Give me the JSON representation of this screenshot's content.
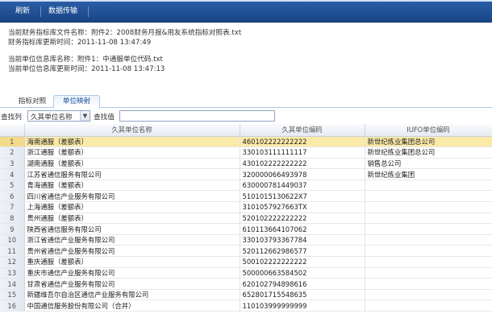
{
  "toolbar": {
    "refresh_label": "刷新",
    "transfer_label": "数据传输"
  },
  "info": {
    "finance_file_label": "当前财务指标库文件名称：附件2：2008财务月报&用友系统指标对照表.txt",
    "finance_updated_label": "财务指标库更新时间：2011-11-08 13:47:49",
    "unit_file_label": "当前单位信息库名称：附件1：中通服单位代码.txt",
    "unit_updated_label": "当前单位信息库更新时间：2011-11-08 13:47:13"
  },
  "tabs": [
    {
      "label": "指标对照",
      "active": false
    },
    {
      "label": "单位映射",
      "active": true
    }
  ],
  "filter": {
    "column_label": "查找列",
    "column_value": "久其单位名称",
    "value_label": "查找值",
    "value": ""
  },
  "table": {
    "columns": [
      "",
      "久其单位名称",
      "久其单位编码",
      "IUFO单位编码"
    ],
    "rows": [
      {
        "num": "1",
        "name": "海南通服（差额表）",
        "code": "460102222222222",
        "iufo": "新世纪练业集团总公司",
        "selected": true
      },
      {
        "num": "2",
        "name": "浙江通服（差额表）",
        "code": "330103111111117",
        "iufo": "新世纪练业集团总公司",
        "selected": false
      },
      {
        "num": "3",
        "name": "湖南通服（差额表）",
        "code": "430102222222222",
        "iufo": "销售总公司",
        "selected": false
      },
      {
        "num": "4",
        "name": "江苏省通信服务有限公司",
        "code": "320000066493978",
        "iufo": "新世纪练业集团",
        "selected": false
      },
      {
        "num": "5",
        "name": "青海通服（差额表）",
        "code": "630000781449037",
        "iufo": "",
        "selected": false
      },
      {
        "num": "6",
        "name": "四川省通信产业服务有限公司",
        "code": "5101015130622X7",
        "iufo": "",
        "selected": false
      },
      {
        "num": "7",
        "name": "上海通服（差额表）",
        "code": "3101057927663TX",
        "iufo": "",
        "selected": false
      },
      {
        "num": "8",
        "name": "贵州通服（差额表）",
        "code": "520102222222222",
        "iufo": "",
        "selected": false
      },
      {
        "num": "9",
        "name": "陕西省通信服务有限公司",
        "code": "610113664107062",
        "iufo": "",
        "selected": false
      },
      {
        "num": "10",
        "name": "浙江省通信产业服务有限公司",
        "code": "330103793367784",
        "iufo": "",
        "selected": false
      },
      {
        "num": "11",
        "name": "贵州省通信产业服务有限公司",
        "code": "520112662986577",
        "iufo": "",
        "selected": false
      },
      {
        "num": "12",
        "name": "重庆通服（差额表）",
        "code": "500102222222222",
        "iufo": "",
        "selected": false
      },
      {
        "num": "13",
        "name": "重庆市通信产业服务有限公司",
        "code": "500000663584502",
        "iufo": "",
        "selected": false
      },
      {
        "num": "14",
        "name": "甘肃省通信产业服务有限公司",
        "code": "620102794898616",
        "iufo": "",
        "selected": false
      },
      {
        "num": "15",
        "name": "新疆维吾尔自治区通信产业服务有限公司",
        "code": "652801715548635",
        "iufo": "",
        "selected": false
      },
      {
        "num": "16",
        "name": "中国通信服务股份有限公司（合并）",
        "code": "110103999999999",
        "iufo": "",
        "selected": false
      }
    ]
  },
  "colors": {
    "toolbar": "#1f4c8f",
    "selected_row": "#fbeaa7",
    "tab_active_text": "#1d4f9a"
  }
}
